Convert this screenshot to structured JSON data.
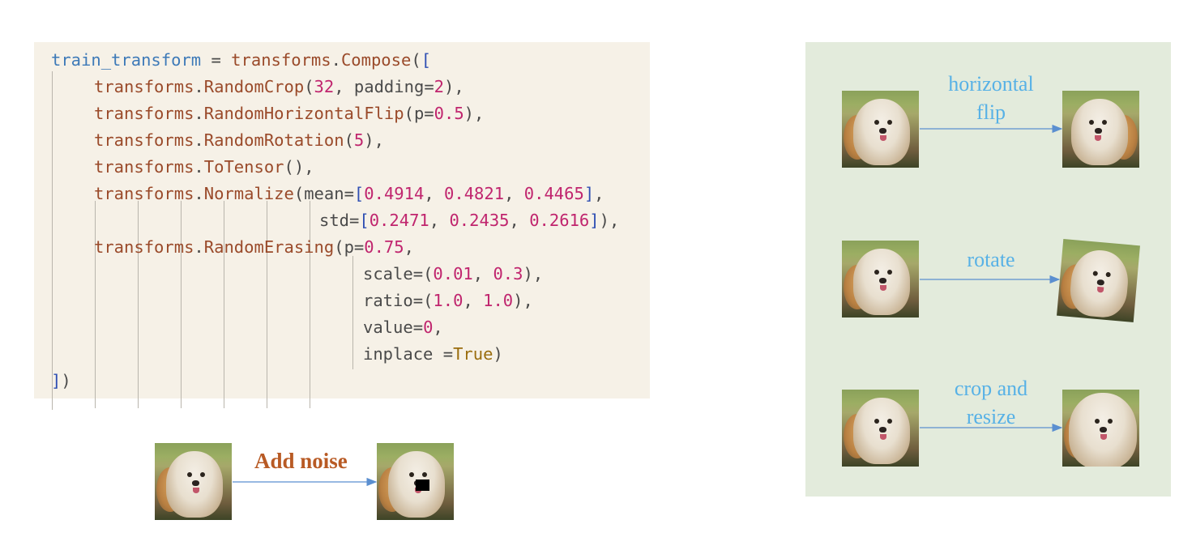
{
  "code": {
    "lines": [
      "train_transform = transforms.Compose([",
      "transforms.RandomCrop(32, padding=2),",
      "transforms.RandomHorizontalFlip(p=0.5),",
      "transforms.RandomRotation(5),",
      "transforms.ToTensor(),",
      "transforms.Normalize(mean=[0.4914, 0.4821, 0.4465],",
      "std=[0.2471, 0.2435, 0.2616]),",
      "transforms.RandomErasing(p=0.75,",
      "scale=(0.01, 0.3),",
      "ratio=(1.0, 1.0),",
      "value=0,",
      "inplace =True)",
      "])"
    ]
  },
  "noise_example": {
    "label": "Add noise"
  },
  "augmentations": [
    {
      "label": "horizontal\nflip"
    },
    {
      "label": "rotate"
    },
    {
      "label": "crop and\nresize"
    }
  ],
  "colors": {
    "code_background": "#f6f1e7",
    "diagram_background": "#e3ebdc",
    "label_blue": "#57b1e6",
    "noise_label": "#b85a24",
    "arrow": "#5b8fd0"
  },
  "icons": {
    "dog_image": "dog-photo",
    "arrow": "right-arrow-icon"
  }
}
